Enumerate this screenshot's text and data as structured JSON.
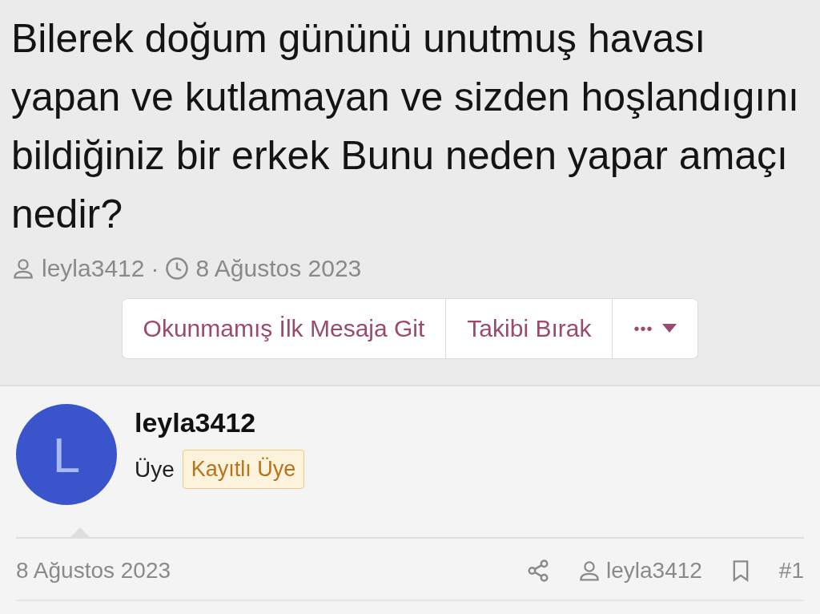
{
  "thread": {
    "title": "Bilerek doğum gününü unutmuş havası yapan ve kutlamayan ve sizden hoşlandıgını bildiğiniz bir erkek Bunu neden yapar amaçı nedir?",
    "author": "leyla3412",
    "separator": "·",
    "date": "8 Ağustos 2023"
  },
  "actions": [
    {
      "label": "Okunmamış İlk Mesaja Git",
      "kind": "text"
    },
    {
      "label": "Takibi Bırak",
      "kind": "text"
    },
    {
      "label": "•••",
      "kind": "menu"
    }
  ],
  "post": {
    "avatar_letter": "L",
    "username": "leyla3412",
    "role": "Üye",
    "badge": "Kayıtlı Üye",
    "date": "8 Ağustos 2023",
    "author": "leyla3412",
    "number": "#1"
  }
}
